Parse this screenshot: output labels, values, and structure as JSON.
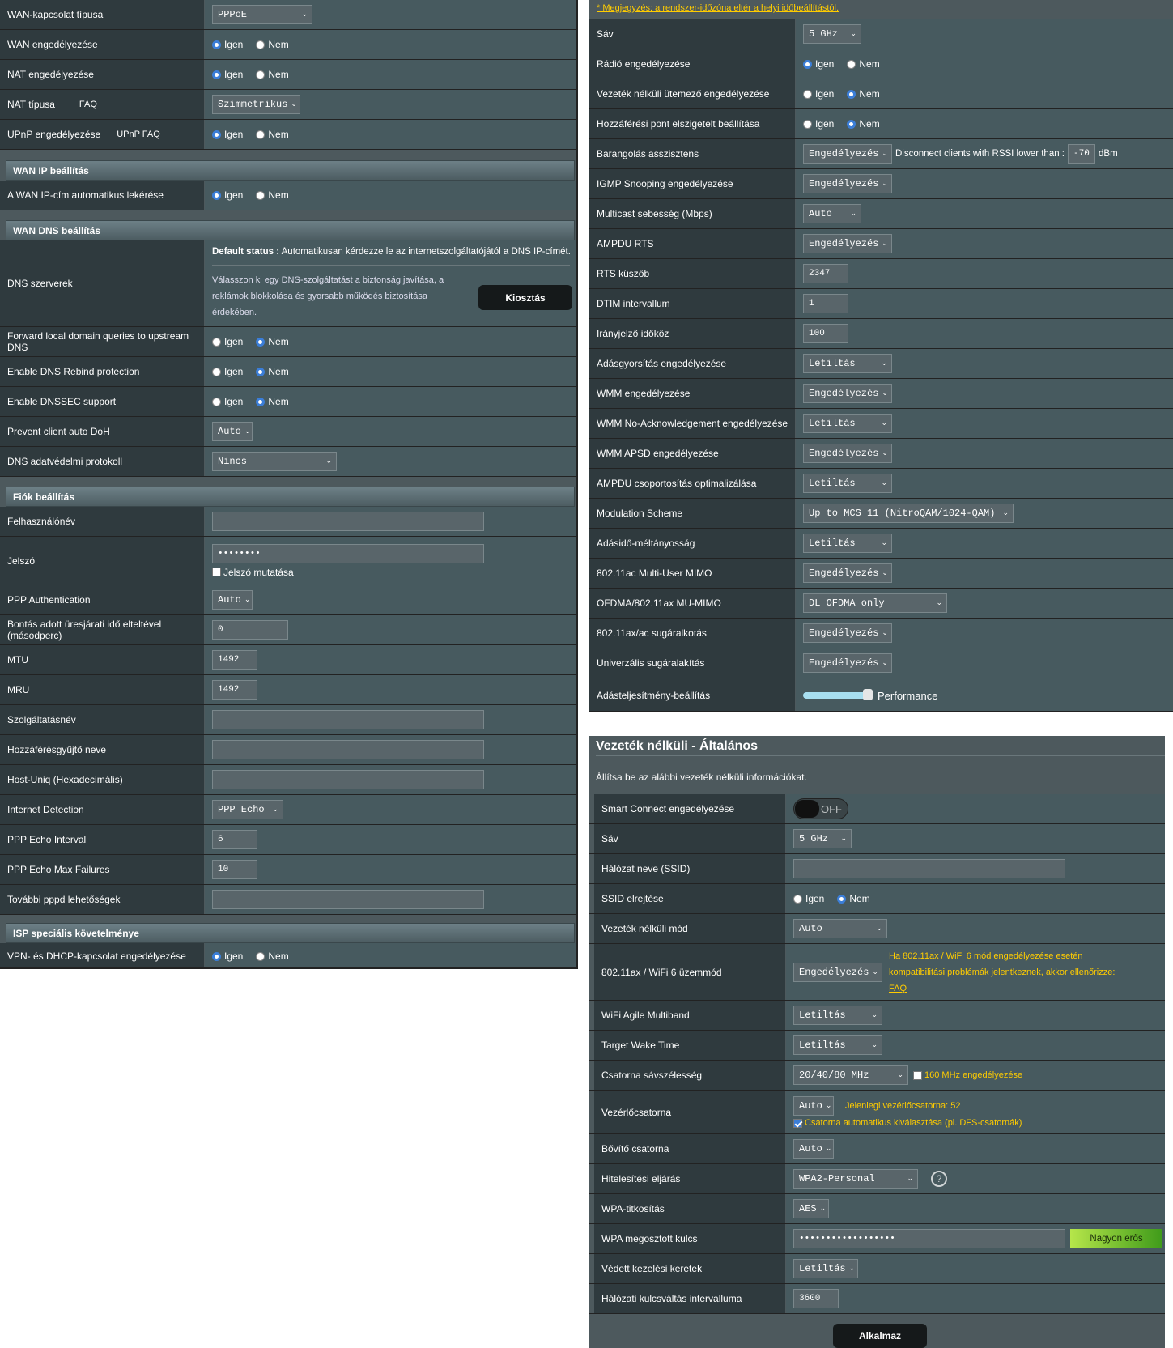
{
  "left": {
    "wan_type": {
      "label": "WAN-kapcsolat típusa",
      "value": "PPPoE"
    },
    "wan_enable": {
      "label": "WAN engedélyezése",
      "yes": "Igen",
      "no": "Nem"
    },
    "nat_enable": {
      "label": "NAT engedélyezése",
      "yes": "Igen",
      "no": "Nem"
    },
    "nat_type": {
      "label": "NAT típusa",
      "faq": "FAQ",
      "value": "Szimmetrikus"
    },
    "upnp": {
      "label": "UPnP engedélyezése",
      "faq": "UPnP FAQ",
      "yes": "Igen",
      "no": "Nem"
    },
    "wan_ip_header": "WAN IP beállítás",
    "wan_ip_auto": {
      "label": "A WAN IP-cím automatikus lekérése",
      "yes": "Igen",
      "no": "Nem"
    },
    "wan_dns_header": "WAN DNS beállítás",
    "dns": {
      "label": "DNS szerverek",
      "status_bold": "Default status :",
      "status_text": "Automatikusan kérdezze le az internetszolgáltatójától a DNS IP-címét.",
      "desc": "Válasszon ki egy DNS-szolgáltatást a biztonság javítása, a reklámok blokkolása és gyorsabb működés biztosítása érdekében.",
      "button": "Kiosztás"
    },
    "fwd_local": {
      "label": "Forward local domain queries to upstream DNS",
      "yes": "Igen",
      "no": "Nem"
    },
    "rebind": {
      "label": "Enable DNS Rebind protection",
      "yes": "Igen",
      "no": "Nem"
    },
    "dnssec": {
      "label": "Enable DNSSEC support",
      "yes": "Igen",
      "no": "Nem"
    },
    "doh": {
      "label": "Prevent client auto DoH",
      "value": "Auto"
    },
    "dns_privacy": {
      "label": "DNS adatvédelmi protokoll",
      "value": "Nincs"
    },
    "account_header": "Fiók beállítás",
    "username": {
      "label": "Felhasználónév",
      "value": ""
    },
    "password": {
      "label": "Jelszó",
      "value": "••••••••",
      "show": "Jelszó mutatása"
    },
    "ppp_auth": {
      "label": "PPP Authentication",
      "value": "Auto"
    },
    "idle": {
      "label": "Bontás adott üresjárati idő elteltével (másodperc)",
      "value": "0"
    },
    "mtu": {
      "label": "MTU",
      "value": "1492"
    },
    "mru": {
      "label": "MRU",
      "value": "1492"
    },
    "service": {
      "label": "Szolgáltatásnév",
      "value": ""
    },
    "ac_name": {
      "label": "Hozzáférésgyűjtő neve",
      "value": ""
    },
    "host_uniq": {
      "label": "Host-Uniq (Hexadecimális)",
      "value": ""
    },
    "inet_detect": {
      "label": "Internet Detection",
      "value": "PPP Echo"
    },
    "echo_interval": {
      "label": "PPP Echo Interval",
      "value": "6"
    },
    "echo_fail": {
      "label": "PPP Echo Max Failures",
      "value": "10"
    },
    "pppd": {
      "label": "További pppd lehetőségek",
      "value": ""
    },
    "isp_header": "ISP speciális követelménye",
    "vpn_dhcp": {
      "label": "VPN- és DHCP-kapcsolat engedélyezése",
      "yes": "Igen",
      "no": "Nem"
    }
  },
  "right_top": {
    "note": "* Megjegyzés: a rendszer-időzóna eltér a helyi időbeállítástól.",
    "band": {
      "label": "Sáv",
      "value": "5 GHz"
    },
    "radio": {
      "label": "Rádió engedélyezése",
      "yes": "Igen",
      "no": "Nem"
    },
    "scheduler": {
      "label": "Vezeték nélküli ütemező engedélyezése",
      "yes": "Igen",
      "no": "Nem"
    },
    "ap_isolate": {
      "label": "Hozzáférési pont elszigetelt beállítása",
      "yes": "Igen",
      "no": "Nem"
    },
    "roaming": {
      "label": "Barangolás asszisztens",
      "value": "Engedélyezés",
      "text": "Disconnect clients with RSSI lower than :",
      "rssi": "-70",
      "unit": "dBm"
    },
    "igmp": {
      "label": "IGMP Snooping engedélyezése",
      "value": "Engedélyezés"
    },
    "multicast": {
      "label": "Multicast sebesség (Mbps)",
      "value": "Auto"
    },
    "ampdu_rts": {
      "label": "AMPDU RTS",
      "value": "Engedélyezés"
    },
    "rts": {
      "label": "RTS küszöb",
      "value": "2347"
    },
    "dtim": {
      "label": "DTIM intervallum",
      "value": "1"
    },
    "beacon": {
      "label": "Irányjelző időköz",
      "value": "100"
    },
    "tx_burst": {
      "label": "Adásgyorsítás engedélyezése",
      "value": "Letiltás"
    },
    "wmm": {
      "label": "WMM engedélyezése",
      "value": "Engedélyezés"
    },
    "wmm_noack": {
      "label": "WMM No-Acknowledgement engedélyezése",
      "value": "Letiltás"
    },
    "wmm_apsd": {
      "label": "WMM APSD engedélyezése",
      "value": "Engedélyezés"
    },
    "ampdu_opt": {
      "label": "AMPDU csoportosítás optimalizálása",
      "value": "Letiltás"
    },
    "modulation": {
      "label": "Modulation Scheme",
      "value": "Up to MCS 11 (NitroQAM/1024-QAM)"
    },
    "airtime": {
      "label": "Adásidő-méltányosság",
      "value": "Letiltás"
    },
    "mumimo": {
      "label": "802.11ac Multi-User MIMO",
      "value": "Engedélyezés"
    },
    "ofdma": {
      "label": "OFDMA/802.11ax MU-MIMO",
      "value": "DL OFDMA only"
    },
    "beamform": {
      "label": "802.11ax/ac sugáralkotás",
      "value": "Engedélyezés"
    },
    "univ_beam": {
      "label": "Univerzális sugáralakítás",
      "value": "Engedélyezés"
    },
    "tx_power": {
      "label": "Adásteljesítmény-beállítás",
      "value": "Performance",
      "level": 1.0
    }
  },
  "right_bottom": {
    "title": "Vezeték nélküli - Általános",
    "subtitle": "Állítsa be az alábbi vezeték nélküli információkat.",
    "smart_connect": {
      "label": "Smart Connect engedélyezése",
      "value": "OFF"
    },
    "band": {
      "label": "Sáv",
      "value": "5 GHz"
    },
    "ssid": {
      "label": "Hálózat neve (SSID)",
      "value": ""
    },
    "hide_ssid": {
      "label": "SSID elrejtése",
      "yes": "Igen",
      "no": "Nem"
    },
    "mode": {
      "label": "Vezeték nélküli mód",
      "value": "Auto"
    },
    "wifi6": {
      "label": "802.11ax / WiFi 6 üzemmód",
      "value": "Engedélyezés",
      "note": "Ha 802.11ax / WiFi 6 mód engedélyezése esetén kompatibilitási problémák jelentkeznek, akkor ellenőrizze:",
      "faq": "FAQ"
    },
    "agile": {
      "label": "WiFi Agile Multiband",
      "value": "Letiltás"
    },
    "twt": {
      "label": "Target Wake Time",
      "value": "Letiltás"
    },
    "bandwidth": {
      "label": "Csatorna sávszélesség",
      "value": "20/40/80 MHz",
      "check": "160 MHz engedélyezése"
    },
    "control": {
      "label": "Vezérlőcsatorna",
      "value": "Auto",
      "current": "Jelenlegi vezérlőcsatorna: 52",
      "check": "Csatorna automatikus kiválasztása (pl. DFS-csatornák)"
    },
    "ext": {
      "label": "Bővítő csatorna",
      "value": "Auto"
    },
    "auth": {
      "label": "Hitelesítési eljárás",
      "value": "WPA2-Personal"
    },
    "wpa_enc": {
      "label": "WPA-titkosítás",
      "value": "AES"
    },
    "psk": {
      "label": "WPA megosztott kulcs",
      "value": "••••••••••••••••••",
      "strength": "Nagyon erős"
    },
    "pmf": {
      "label": "Védett kezelési keretek",
      "value": "Letiltás"
    },
    "rekey": {
      "label": "Hálózati kulcsváltás intervalluma",
      "value": "3600"
    },
    "apply": "Alkalmaz"
  },
  "colors": {
    "panel_bg": "#4d595d",
    "label_bg": "#2f3a3e",
    "note": "#ffcc00",
    "radio_on": "#3b7ed8",
    "strength": "#5aa51a"
  }
}
